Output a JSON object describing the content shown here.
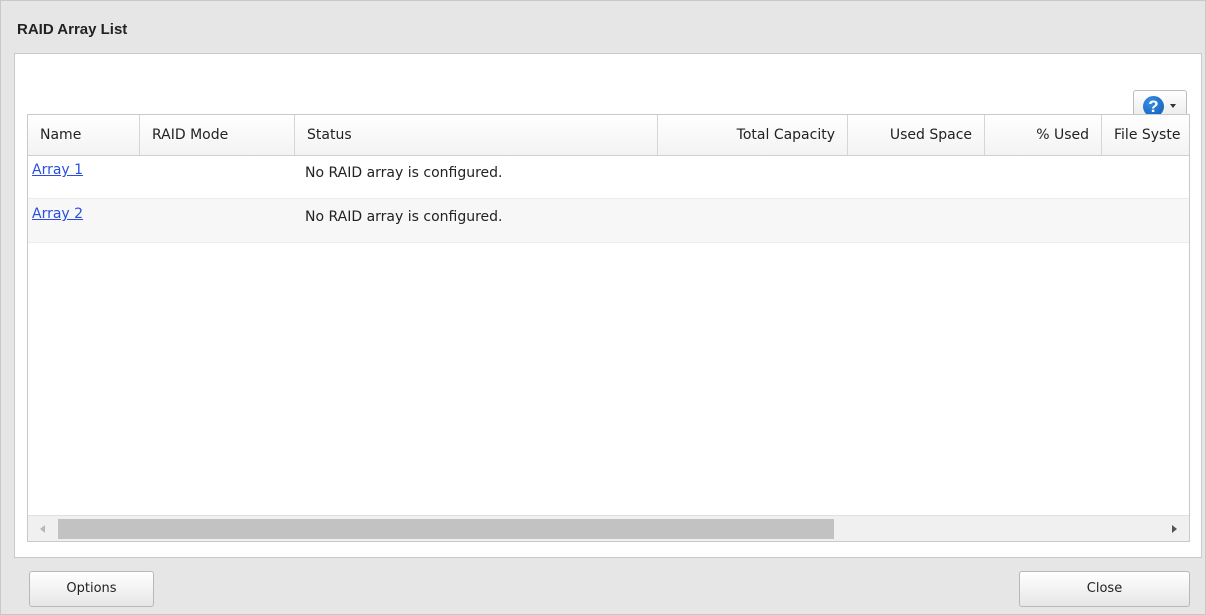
{
  "dialog": {
    "title": "RAID Array List"
  },
  "toolbar": {
    "help_glyph": "?",
    "help_icon": "help-icon",
    "caret_icon": "chevron-down-icon"
  },
  "table": {
    "columns": [
      "Name",
      "RAID Mode",
      "Status",
      "Total Capacity",
      "Used Space",
      "% Used",
      "File Syste"
    ],
    "rows": [
      {
        "name": "Array 1",
        "raid_mode": "",
        "status": "No RAID array is configured.",
        "total_capacity": "",
        "used_space": "",
        "percent_used": "",
        "file_system": ""
      },
      {
        "name": "Array 2",
        "raid_mode": "",
        "status": "No RAID array is configured.",
        "total_capacity": "",
        "used_space": "",
        "percent_used": "",
        "file_system": ""
      }
    ]
  },
  "footer": {
    "options_label": "Options",
    "close_label": "Close"
  },
  "colors": {
    "link": "#2a4fe0",
    "help_blue": "#0a5bb8",
    "dialog_bg": "#e6e6e6"
  }
}
